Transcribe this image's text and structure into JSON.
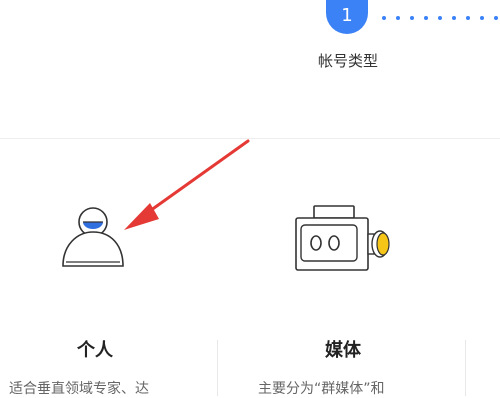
{
  "stepper": {
    "current_step": "1",
    "current_label": "帐号类型",
    "accent": "#3b82f6"
  },
  "options": [
    {
      "title": "个人",
      "desc": "适合垂直领域专家、达",
      "icon": "person-icon"
    },
    {
      "title": "媒体",
      "desc": "主要分为“群媒体”和",
      "icon": "camera-icon"
    }
  ],
  "annotation": {
    "arrow_color": "#e53935"
  }
}
